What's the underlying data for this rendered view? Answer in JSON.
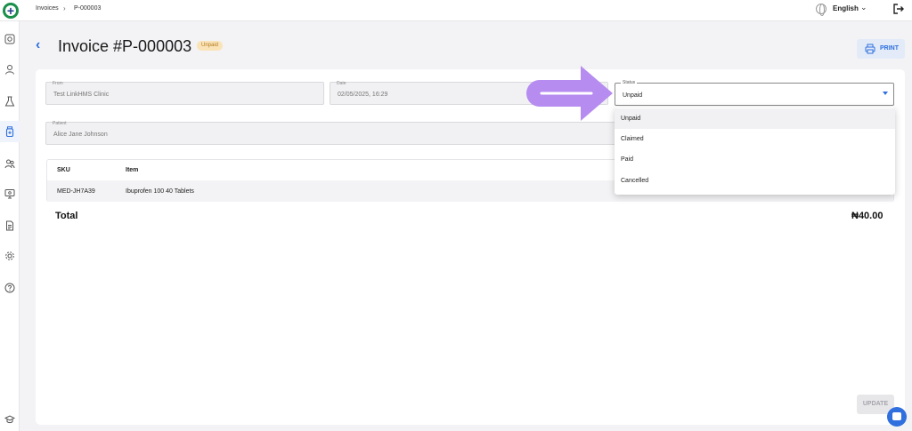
{
  "breadcrumb": {
    "items": [
      "Invoices",
      "P-000003"
    ]
  },
  "topbar": {
    "language": "English"
  },
  "header": {
    "title": "Invoice #P-000003",
    "status_badge": "Unpaid",
    "print_label": "PRINT"
  },
  "form": {
    "from": {
      "label": "From",
      "value": "Test LinkHMS Clinic"
    },
    "date": {
      "label": "Date",
      "value": "02/05/2025, 16:29"
    },
    "status": {
      "label": "Status",
      "value": "Unpaid"
    },
    "patient": {
      "label": "Patient",
      "value": "Alice Jane Johnson"
    }
  },
  "table": {
    "columns": [
      "SKU",
      "Item"
    ],
    "rows": [
      {
        "sku": "MED-JH7A39",
        "item": "Ibuprofen 100 40 Tablets"
      }
    ]
  },
  "total": {
    "label": "Total",
    "value": "₦40.00"
  },
  "status_options": [
    "Unpaid",
    "Claimed",
    "Paid",
    "Cancelled"
  ],
  "actions": {
    "update_label": "UPDATE"
  },
  "colors": {
    "accent": "#2f6fde",
    "annotation": "#b68cf0",
    "badge_bg": "#fbe3b8",
    "badge_text": "#b07a1f"
  },
  "icons": {
    "sidebar": [
      "dashboard-icon",
      "user-icon",
      "lab-icon",
      "medicine-icon",
      "patients-icon",
      "monitor-icon",
      "document-icon",
      "settings-icon",
      "help-icon",
      "graduation-cap-icon"
    ],
    "top": [
      "globe-icon",
      "chevron-down-icon",
      "logout-icon"
    ]
  }
}
